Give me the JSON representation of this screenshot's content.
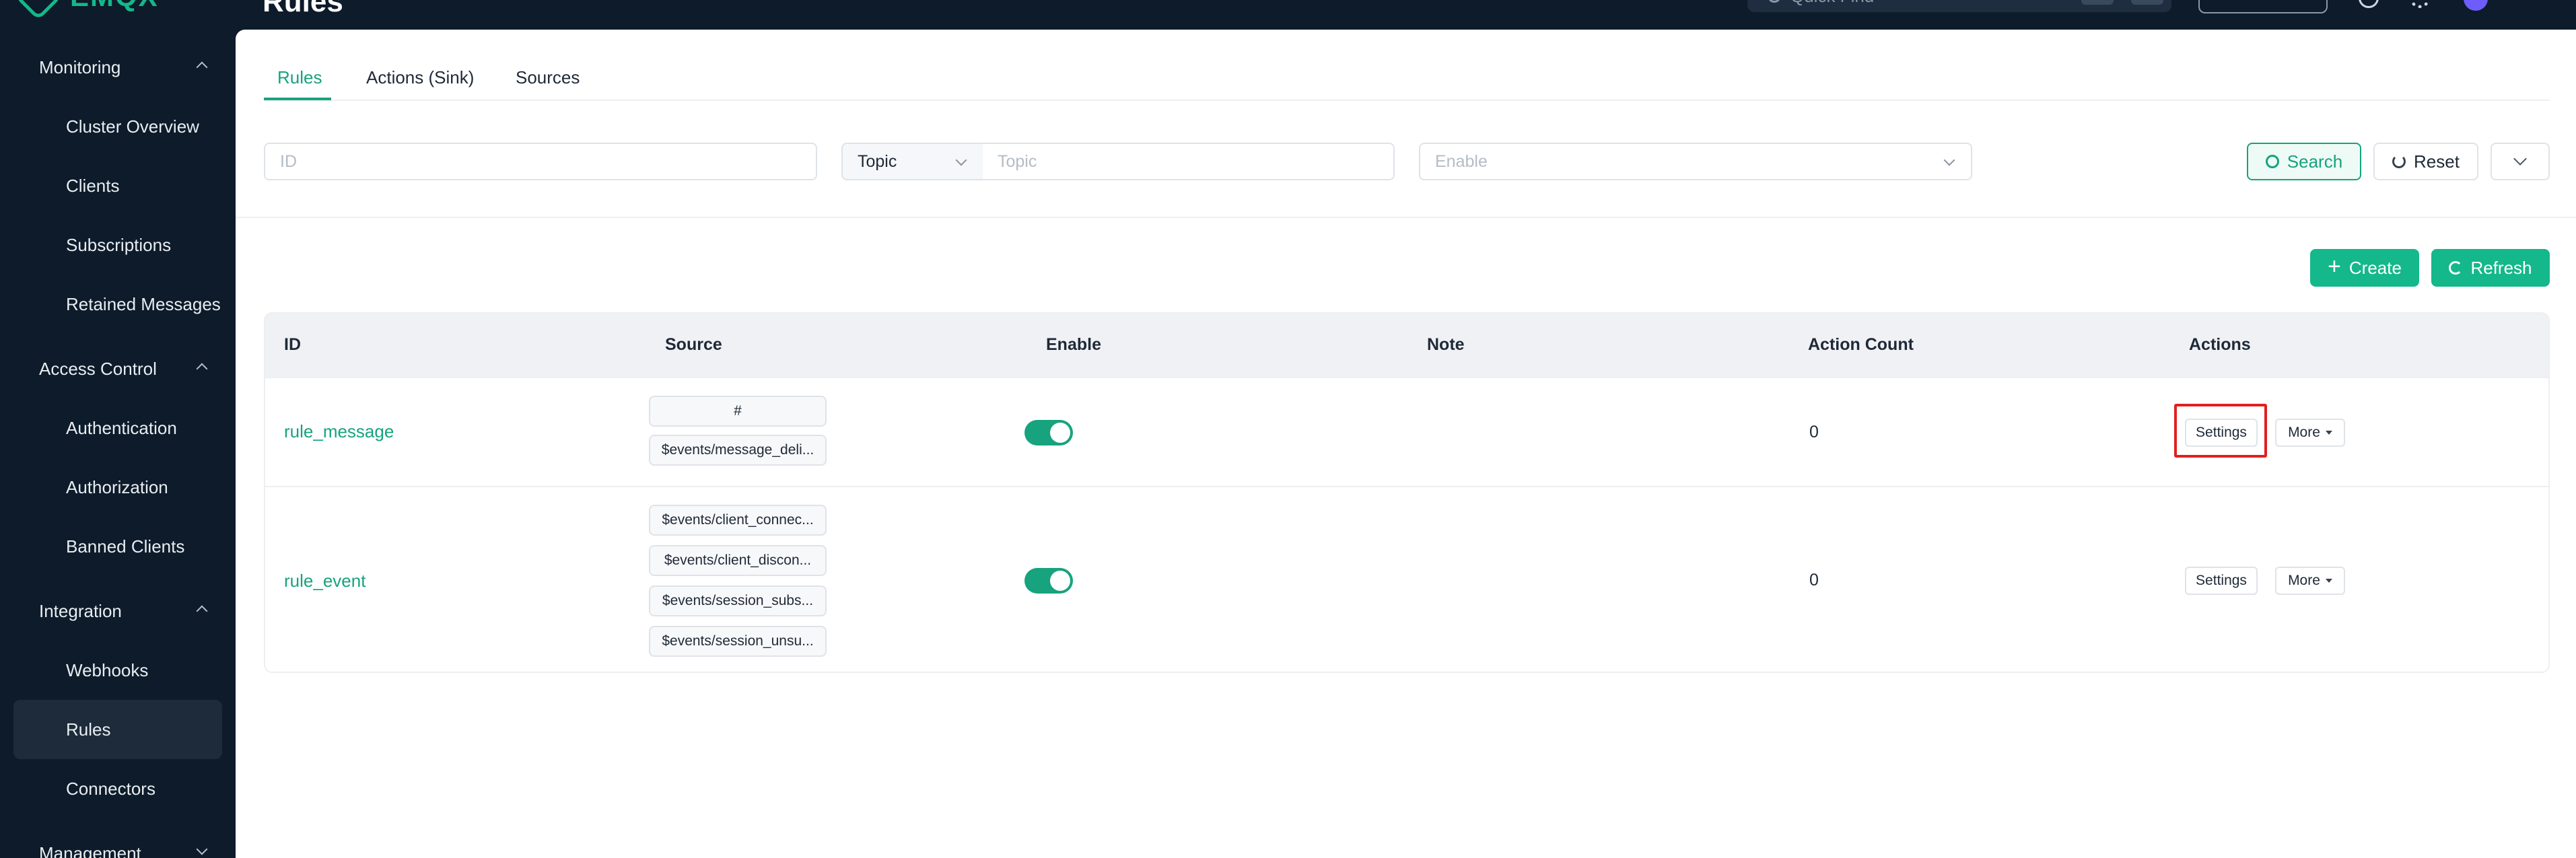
{
  "header": {
    "logo_text": "EMQX",
    "page_title": "Rules",
    "quick_find_placeholder": "Quick Find"
  },
  "sidebar": {
    "groups": [
      {
        "label": "Monitoring",
        "items": [
          "Cluster Overview",
          "Clients",
          "Subscriptions",
          "Retained Messages"
        ]
      },
      {
        "label": "Access Control",
        "items": [
          "Authentication",
          "Authorization",
          "Banned Clients"
        ]
      },
      {
        "label": "Integration",
        "items": [
          "Webhooks",
          "Rules",
          "Connectors"
        ]
      },
      {
        "label": "Management",
        "items": []
      }
    ],
    "active_item": "Rules"
  },
  "tabs": [
    "Rules",
    "Actions (Sink)",
    "Sources"
  ],
  "filters": {
    "id_placeholder": "ID",
    "topic_select_value": "Topic",
    "topic_placeholder": "Topic",
    "enable_placeholder": "Enable",
    "search_label": "Search",
    "reset_label": "Reset"
  },
  "toolbar": {
    "create_label": "Create",
    "refresh_label": "Refresh"
  },
  "table": {
    "columns": [
      "ID",
      "Source",
      "Enable",
      "Note",
      "Action Count",
      "Actions"
    ],
    "rows": [
      {
        "id": "rule_message",
        "sources": [
          "#",
          "$events/message_deli..."
        ],
        "enabled": true,
        "note": "",
        "action_count": "0",
        "settings_label": "Settings",
        "more_label": "More"
      },
      {
        "id": "rule_event",
        "sources": [
          "$events/client_connec...",
          "$events/client_discon...",
          "$events/session_subs...",
          "$events/session_unsu..."
        ],
        "enabled": true,
        "note": "",
        "action_count": "0",
        "settings_label": "Settings",
        "more_label": "More"
      }
    ]
  },
  "colors": {
    "brand": "#14b88a",
    "sidebar_bg": "#0d1b2a",
    "highlight": "#e02020"
  }
}
